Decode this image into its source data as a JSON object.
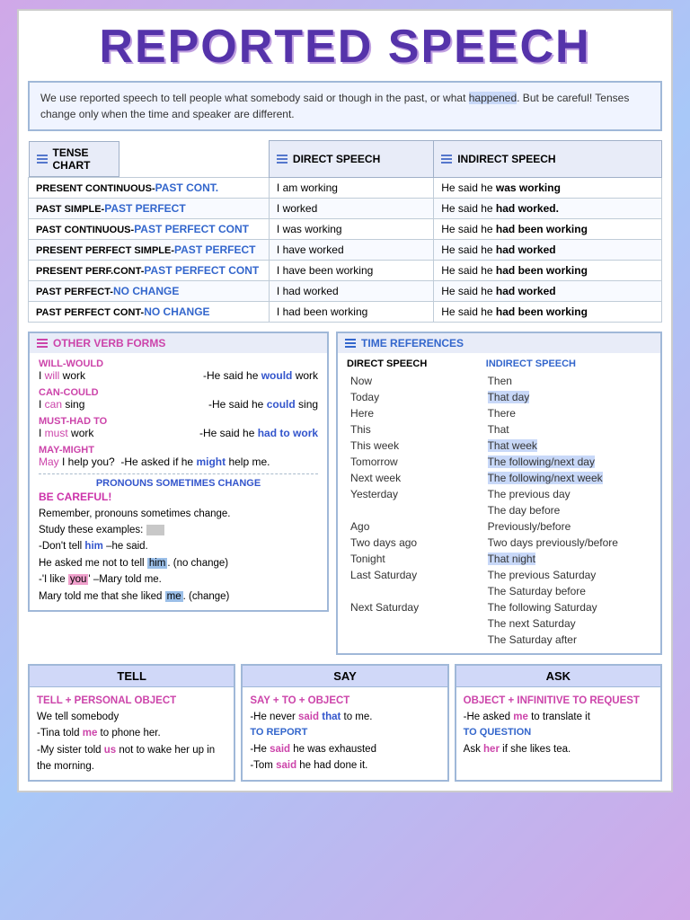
{
  "title": "REPORTED SPEECH",
  "intro": {
    "text": "We use reported speech to tell people what somebody said or though in the past, or what happened. But be careful! Tenses change only when the time and speaker are different."
  },
  "tenseChart": {
    "headers": [
      "TENSE CHART",
      "DIRECT SPEECH",
      "INDIRECT SPEECH"
    ],
    "rows": [
      {
        "tense": "PRESENT CONTINUOUS-",
        "tenseChange": "PAST CONT.",
        "direct": "I am working",
        "indirect": "He said he ",
        "indirectBold": "was working"
      },
      {
        "tense": "PAST SIMPLE-",
        "tenseChange": "PAST PERFECT",
        "direct": "I worked",
        "indirect": "He said he ",
        "indirectBold": "had worked."
      },
      {
        "tense": "PAST CONTINUOUS-",
        "tenseChange": "PAST PERFECT CONT",
        "direct": "I was working",
        "indirect": "He said he ",
        "indirectBold": "had been working"
      },
      {
        "tense": "PRESENT PERFECT SIMPLE-",
        "tenseChange": "PAST PERFECT",
        "direct": "I have worked",
        "indirect": "He said he ",
        "indirectBold": "had worked"
      },
      {
        "tense": "PRESENT PERF.CONT-",
        "tenseChange": "PAST PERFECT CONT",
        "direct": "I have been working",
        "indirect": "He said he ",
        "indirectBold": "had been working"
      },
      {
        "tense": "PAST PERFECT-",
        "tenseChange": "NO CHANGE",
        "direct": "I had worked",
        "indirect": "He said he ",
        "indirectBold": "had worked"
      },
      {
        "tense": "PAST PERFECT CONT-",
        "tenseChange": "NO CHANGE",
        "direct": "I had been working",
        "indirect": "He said he ",
        "indirectBold": "had been working"
      }
    ]
  },
  "otherVerbForms": {
    "title": "OTHER VERB FORMS",
    "groups": [
      {
        "label": "WILL-WOULD",
        "leftEx": "I will work",
        "rightEx": "-He said he would work",
        "willWord": "will",
        "wouldWord": "would"
      },
      {
        "label": "CAN-COULD",
        "leftEx": "I can sing",
        "rightEx": "-He said he could sing",
        "canWord": "can",
        "couldWord": "could"
      },
      {
        "label": "MUST-HAD TO",
        "leftEx": "I must work",
        "rightEx": "-He said he had to work",
        "mustWord": "must",
        "hadToPhrase": "had to work"
      },
      {
        "label": "MAY-MIGHT",
        "fullEx": "May I help you?  -He asked if he might help me.",
        "mayWord": "May",
        "mightWord": "might"
      }
    ],
    "pronounsHeader": "PRONOUNS SOMETIMES CHANGE"
  },
  "careful": {
    "label": "BE CAREFUL!",
    "lines": [
      "Remember, pronouns sometimes change.",
      "Study these examples:",
      "-Don't tell him –he said.",
      "He asked me not to tell him. (no change)",
      "-'I like you' –Mary told me.",
      "Mary told me that she liked me. (change)"
    ]
  },
  "timeReferences": {
    "title": "TIME REFERENCES",
    "dsHeader": "DIRECT SPEECH",
    "isHeader": "INDIRECT SPEECH",
    "rows": [
      {
        "direct": "Now",
        "indirect": "Then",
        "highlight": false
      },
      {
        "direct": "Today",
        "indirect": "That day",
        "highlight": true
      },
      {
        "direct": "Here",
        "indirect": "There",
        "highlight": false
      },
      {
        "direct": "This",
        "indirect": "That",
        "highlight": false
      },
      {
        "direct": "This week",
        "indirect": "That week",
        "highlight": true
      },
      {
        "direct": "Tomorrow",
        "indirect": "The following/next day",
        "highlight": true
      },
      {
        "direct": "Next week",
        "indirect": "The following/next week",
        "highlight": true
      },
      {
        "direct": "Yesterday",
        "indirect": "The previous day",
        "highlight": false
      },
      {
        "direct": "",
        "indirect": "The day before",
        "highlight": false
      },
      {
        "direct": "Ago",
        "indirect": "Previously/before",
        "highlight": false
      },
      {
        "direct": "Two days ago",
        "indirect": "Two days previously/before",
        "highlight": false
      },
      {
        "direct": "Tonight",
        "indirect": "That night",
        "highlight": true
      },
      {
        "direct": "Last Saturday",
        "indirect": "The previous Saturday",
        "highlight": false
      },
      {
        "direct": "",
        "indirect": "The Saturday before",
        "highlight": false
      },
      {
        "direct": "Next Saturday",
        "indirect": "The following Saturday",
        "highlight": false
      },
      {
        "direct": "",
        "indirect": "The next Saturday",
        "highlight": false
      },
      {
        "direct": "",
        "indirect": "The Saturday after",
        "highlight": false
      }
    ]
  },
  "bottomCards": [
    {
      "header": "TELL",
      "subheader": "TELL + PERSONAL OBJECT",
      "line1": "We tell somebody",
      "examples": [
        "-Tina told me to phone her.",
        "-My sister told us not to wake her up in the morning."
      ],
      "meWord": "me",
      "usWord": "us"
    },
    {
      "header": "SAY",
      "subheader": "SAY + TO + OBJECT",
      "line1": "-He never said that to me.",
      "subheader2": "TO REPORT",
      "examples": [
        "-He said he was exhausted",
        "-Tom said he had done it."
      ],
      "saidWord": "said",
      "saidWord2": "said",
      "thatWord": "that"
    },
    {
      "header": "ASK",
      "subheader": "OBJECT + INFINITIVE TO REQUEST",
      "line1": "-He asked me to translate it",
      "subheader2": "TO QUESTION",
      "line2": "Ask her if she likes tea.",
      "meWord": "me",
      "herWord": "her"
    }
  ]
}
